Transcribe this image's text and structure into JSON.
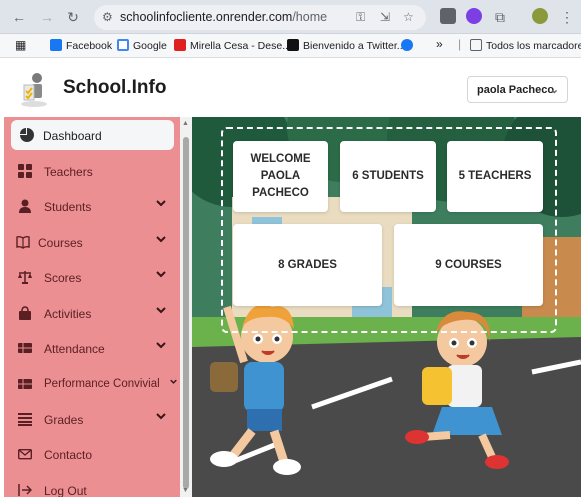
{
  "browser": {
    "url_domain": "schoolinfocliente.onrender.com",
    "url_path": "/home",
    "bookmarks": [
      "Facebook",
      "Google",
      "Mirella Cesa - Dese...",
      "Bienvenido a Twitter...",
      "Todos los marcadores"
    ],
    "more_bookmarks": "»"
  },
  "header": {
    "brand": "School.Info",
    "user_name": "paola Pacheco"
  },
  "sidebar": {
    "items": [
      {
        "label": "Dashboard",
        "icon": "pie-chart-icon"
      },
      {
        "label": "Teachers",
        "icon": "grid-icon"
      },
      {
        "label": "Students",
        "icon": "person-icon"
      },
      {
        "label": "Courses",
        "icon": "book-icon"
      },
      {
        "label": "Scores",
        "icon": "balance-scale-icon"
      },
      {
        "label": "Activities",
        "icon": "bag-icon"
      },
      {
        "label": "Attendance",
        "icon": "table-icon"
      },
      {
        "label": "Performance Convivial",
        "icon": "table-icon"
      },
      {
        "label": "Grades",
        "icon": "list-icon"
      },
      {
        "label": "Contacto",
        "icon": "envelope-icon"
      },
      {
        "label": "Log Out",
        "icon": "logout-icon"
      }
    ]
  },
  "dashboard": {
    "welcome_line1": "WELCOME",
    "welcome_line2": "PAOLA",
    "welcome_line3": "PACHECO",
    "students": "6 STUDENTS",
    "teachers": "5 TEACHERS",
    "grades": "8 GRADES",
    "courses": "9 COURSES"
  },
  "colors": {
    "sidebar": "#eb8f93",
    "sky": "#2f6f56",
    "road": "#4a4a4a"
  }
}
